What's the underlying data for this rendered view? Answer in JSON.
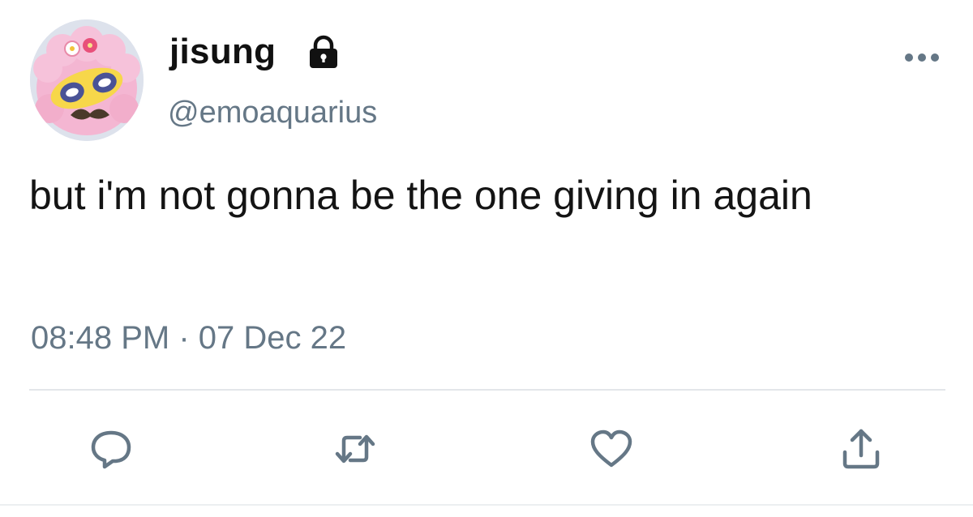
{
  "user": {
    "display_name": "jisung",
    "handle": "@emoaquarius",
    "locked_icon": "lock-icon"
  },
  "tweet": {
    "text": "but i'm not gonna be the one giving in again",
    "timestamp": "08:48 PM · 07 Dec 22"
  },
  "actions": [
    {
      "name": "reply",
      "icon": "speech-bubble-icon"
    },
    {
      "name": "retweet",
      "icon": "retweet-arrows-icon"
    },
    {
      "name": "like",
      "icon": "heart-icon"
    },
    {
      "name": "share",
      "icon": "upload-icon"
    }
  ],
  "menu": {
    "icon": "more-dots-icon"
  },
  "colors": {
    "text": "#141414",
    "secondary": "#657786",
    "icon": "#657786",
    "divider": "#e3e6ea",
    "avatar_pink": "#f4b6d2"
  }
}
